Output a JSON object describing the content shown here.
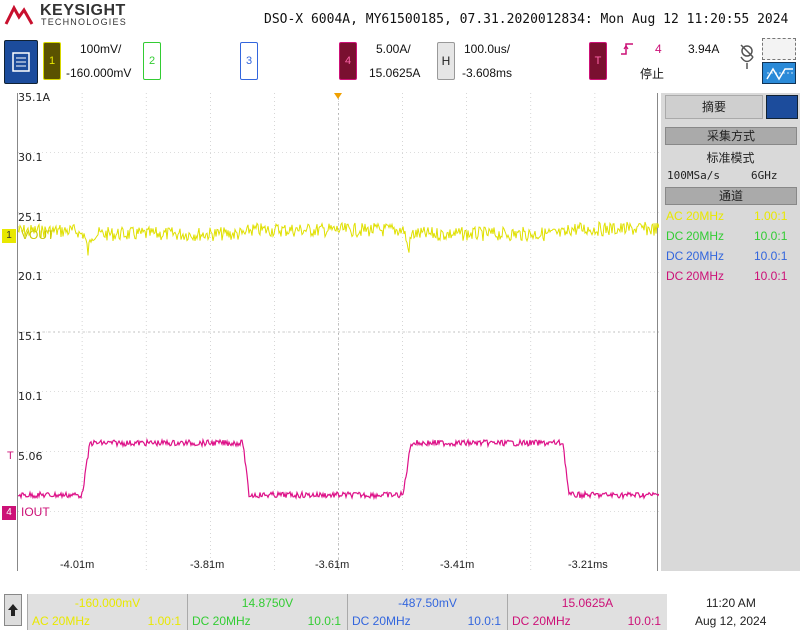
{
  "header": {
    "brand": "KEYSIGHT",
    "brand_sub": "TECHNOLOGIES",
    "title": "DSO-X 6004A, MY61500185, 07.31.2020012834: Mon Aug 12 11:20:55 2024"
  },
  "channels": {
    "ch1": {
      "num": "1",
      "scale": "100mV/",
      "offset": "-160.000mV",
      "color": "#e8e800"
    },
    "ch2": {
      "num": "2",
      "color": "#33cc33"
    },
    "ch3": {
      "num": "3",
      "color": "#3366dd"
    },
    "ch4": {
      "num": "4",
      "scale": "5.00A/",
      "offset": "15.0625A",
      "color": "#cc1177"
    }
  },
  "horizontal": {
    "label": "H",
    "scale": "100.0us/",
    "delay": "-3.608ms"
  },
  "trigger": {
    "label": "T",
    "source": "4",
    "level": "3.94A",
    "status": "停止"
  },
  "plot": {
    "y_labels": [
      "35.1A",
      "30.1",
      "25.1",
      "20.1",
      "15.1",
      "10.1",
      "5.06"
    ],
    "x_labels": [
      "-4.01m",
      "-3.81m",
      "-3.61m",
      "-3.41m",
      "-3.21ms"
    ],
    "trace1_label": "VOUT",
    "trace4_label": "IOUT",
    "marker1": "1",
    "marker4": "4",
    "trig_marker": "T"
  },
  "side_panel": {
    "tab_label": "摘要",
    "acq_header": "采集方式",
    "acq_mode": "标准模式",
    "sample_rate": "100MSa/s",
    "bandwidth": "6GHz",
    "channel_header": "通道",
    "rows": [
      {
        "coupling": "AC",
        "bw": "20MHz",
        "probe": "1.00:1",
        "color": "#e8e800"
      },
      {
        "coupling": "DC",
        "bw": "20MHz",
        "probe": "10.0:1",
        "color": "#33cc33"
      },
      {
        "coupling": "DC",
        "bw": "20MHz",
        "probe": "10.0:1",
        "color": "#3366dd"
      },
      {
        "coupling": "DC",
        "bw": "20MHz",
        "probe": "10.0:1",
        "color": "#cc1177"
      }
    ]
  },
  "bottom": {
    "cols": [
      {
        "value": "-160.000mV",
        "setting": "AC 20MHz",
        "probe": "1.00:1",
        "color": "#e8e800"
      },
      {
        "value": "14.8750V",
        "setting": "DC 20MHz",
        "probe": "10.0:1",
        "color": "#33cc33"
      },
      {
        "value": "-487.50mV",
        "setting": "DC 20MHz",
        "probe": "10.0:1",
        "color": "#3366dd"
      },
      {
        "value": "15.0625A",
        "setting": "DC 20MHz",
        "probe": "10.0:1",
        "color": "#cc1177"
      }
    ],
    "time": "11:20 AM",
    "date": "Aug 12, 2024"
  }
}
